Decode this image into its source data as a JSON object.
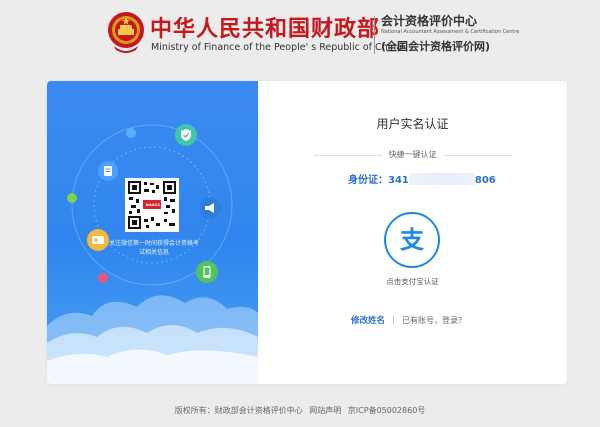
{
  "header": {
    "ministry_cn": "中华人民共和国财政部",
    "ministry_en": "Ministry of Finance of the People' s Republic of China",
    "center_cn": "会计资格评价中心",
    "center_en": "National Accountant Assessment & Certification Centre",
    "center_web": "(全国会计资格评价网)"
  },
  "left_panel": {
    "qr_badge": "NAACC",
    "qr_caption": "关注微信第一时间获得会计资格考试相关信息"
  },
  "auth": {
    "title": "用户实名认证",
    "quick_label": "快捷一键认证",
    "id_prefix": "身份证：",
    "id_visible_start": "341",
    "id_visible_end": "806",
    "alipay_icon_glyph": "支",
    "alipay_caption": "点击支付宝认证",
    "edit_name_link": "修改姓名",
    "login_link": "已有账号，登录?"
  },
  "footer": {
    "copyright": "版权所有：财政部会计资格评价中心",
    "statement": "网站声明",
    "icp": "京ICP备05002860号"
  },
  "colors": {
    "brand_red": "#c8161d",
    "panel_blue": "#2f86ee",
    "link_blue": "#2a6fd8",
    "alipay_blue": "#1e88e5"
  }
}
